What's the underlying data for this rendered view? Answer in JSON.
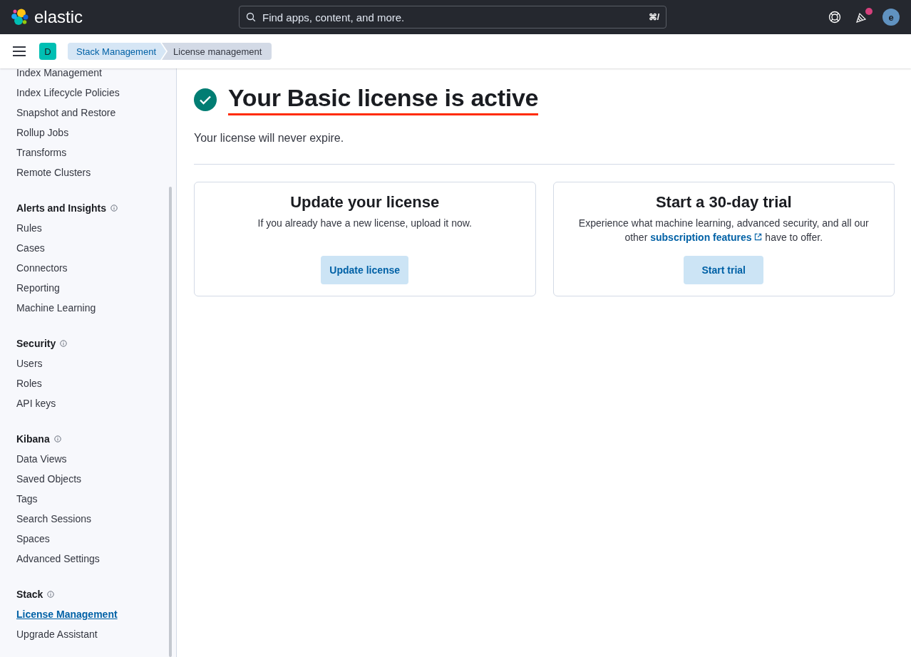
{
  "header": {
    "logo_text": "elastic",
    "search": {
      "placeholder": "Find apps, content, and more.",
      "shortcut": "⌘/"
    },
    "notification_dot": true,
    "avatar_initial": "e"
  },
  "breadcrumbs": {
    "space_initial": "D",
    "items": [
      {
        "label": "Stack Management",
        "selected": false
      },
      {
        "label": "License management",
        "selected": true
      }
    ]
  },
  "sidebar": {
    "sections": [
      {
        "items": [
          {
            "label": "Index Management",
            "selected": false
          },
          {
            "label": "Index Lifecycle Policies",
            "selected": false
          },
          {
            "label": "Snapshot and Restore",
            "selected": false
          },
          {
            "label": "Rollup Jobs",
            "selected": false
          },
          {
            "label": "Transforms",
            "selected": false
          },
          {
            "label": "Remote Clusters",
            "selected": false
          }
        ]
      },
      {
        "title": "Alerts and Insights",
        "items": [
          {
            "label": "Rules",
            "selected": false
          },
          {
            "label": "Cases",
            "selected": false
          },
          {
            "label": "Connectors",
            "selected": false
          },
          {
            "label": "Reporting",
            "selected": false
          },
          {
            "label": "Machine Learning",
            "selected": false
          }
        ]
      },
      {
        "title": "Security",
        "items": [
          {
            "label": "Users",
            "selected": false
          },
          {
            "label": "Roles",
            "selected": false
          },
          {
            "label": "API keys",
            "selected": false
          }
        ]
      },
      {
        "title": "Kibana",
        "items": [
          {
            "label": "Data Views",
            "selected": false
          },
          {
            "label": "Saved Objects",
            "selected": false
          },
          {
            "label": "Tags",
            "selected": false
          },
          {
            "label": "Search Sessions",
            "selected": false
          },
          {
            "label": "Spaces",
            "selected": false
          },
          {
            "label": "Advanced Settings",
            "selected": false
          }
        ]
      },
      {
        "title": "Stack",
        "items": [
          {
            "label": "License Management",
            "selected": true
          },
          {
            "label": "Upgrade Assistant",
            "selected": false
          }
        ]
      }
    ]
  },
  "status": {
    "title": "Your Basic license is active",
    "underlined": true,
    "description": "Your license will never expire."
  },
  "cards": [
    {
      "title": "Update your license",
      "text_before": "If you already have a new license, upload it now.",
      "button": "Update license"
    },
    {
      "title": "Start a 30-day trial",
      "text_before": "Experience what machine learning, advanced security, and all our other",
      "link": "subscription features",
      "text_after": "have to offer.",
      "button": "Start trial"
    }
  ]
}
